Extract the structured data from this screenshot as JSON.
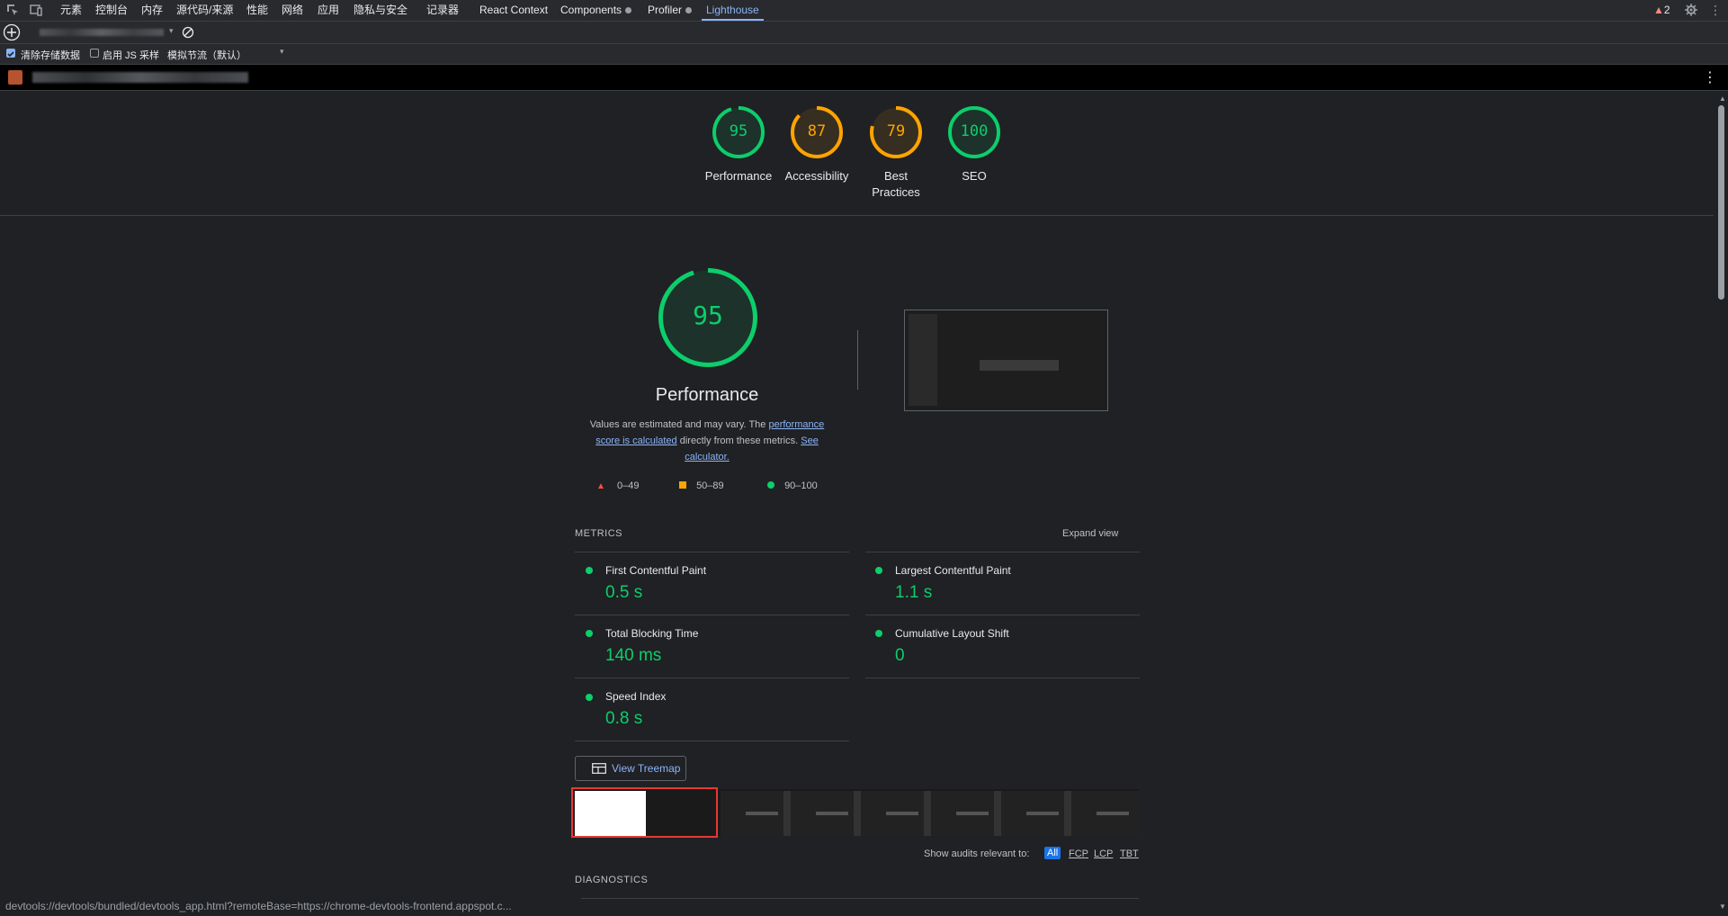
{
  "tabs": {
    "items": [
      {
        "label": "元素"
      },
      {
        "label": "控制台"
      },
      {
        "label": "内存"
      },
      {
        "label": "源代码/来源"
      },
      {
        "label": "性能"
      },
      {
        "label": "网络"
      },
      {
        "label": "应用"
      },
      {
        "label": "隐私与安全"
      },
      {
        "label": "记录器"
      },
      {
        "label": "React Context"
      },
      {
        "label": "Components"
      },
      {
        "label": "Profiler"
      },
      {
        "label": "Lighthouse"
      }
    ],
    "warning_count": "2"
  },
  "toolbar": {
    "clear_storage_label": "清除存储数据",
    "js_sampling_label": "启用 JS 采样",
    "throttling_label": "模拟节流（默认）"
  },
  "scores": [
    {
      "value": "95",
      "label": "Performance",
      "color": "#0cce6b",
      "fraction": 0.95
    },
    {
      "value": "87",
      "label": "Accessibility",
      "color": "#ffa400",
      "fraction": 0.87
    },
    {
      "value": "79",
      "label": "Best Practices",
      "color": "#ffa400",
      "fraction": 0.79
    },
    {
      "value": "100",
      "label": "SEO",
      "color": "#0cce6b",
      "fraction": 1.0
    }
  ],
  "performance": {
    "score": "95",
    "title": "Performance",
    "desc_prefix": "Values are estimated and may vary. The ",
    "desc_link1": "performance score is calculated",
    "desc_mid": " directly from these metrics. ",
    "desc_link2": "See calculator.",
    "legend": {
      "fail": "0–49",
      "average": "50–89",
      "pass": "90–100"
    }
  },
  "metrics": {
    "header": "METRICS",
    "expand": "Expand view",
    "fcp_label": "First Contentful Paint",
    "fcp_value": "0.5 s",
    "lcp_label": "Largest Contentful Paint",
    "lcp_value": "1.1 s",
    "tbt_label": "Total Blocking Time",
    "tbt_value": "140 ms",
    "cls_label": "Cumulative Layout Shift",
    "cls_value": "0",
    "si_label": "Speed Index",
    "si_value": "0.8 s"
  },
  "treemap_button": "View Treemap",
  "filter": {
    "label": "Show audits relevant to:",
    "options": [
      "All",
      "FCP",
      "LCP",
      "TBT"
    ]
  },
  "diagnostics_header": "DIAGNOSTICS",
  "status_url": "devtools://devtools/bundled/devtools_app.html?remoteBase=https://chrome-devtools-frontend.appspot.c..."
}
